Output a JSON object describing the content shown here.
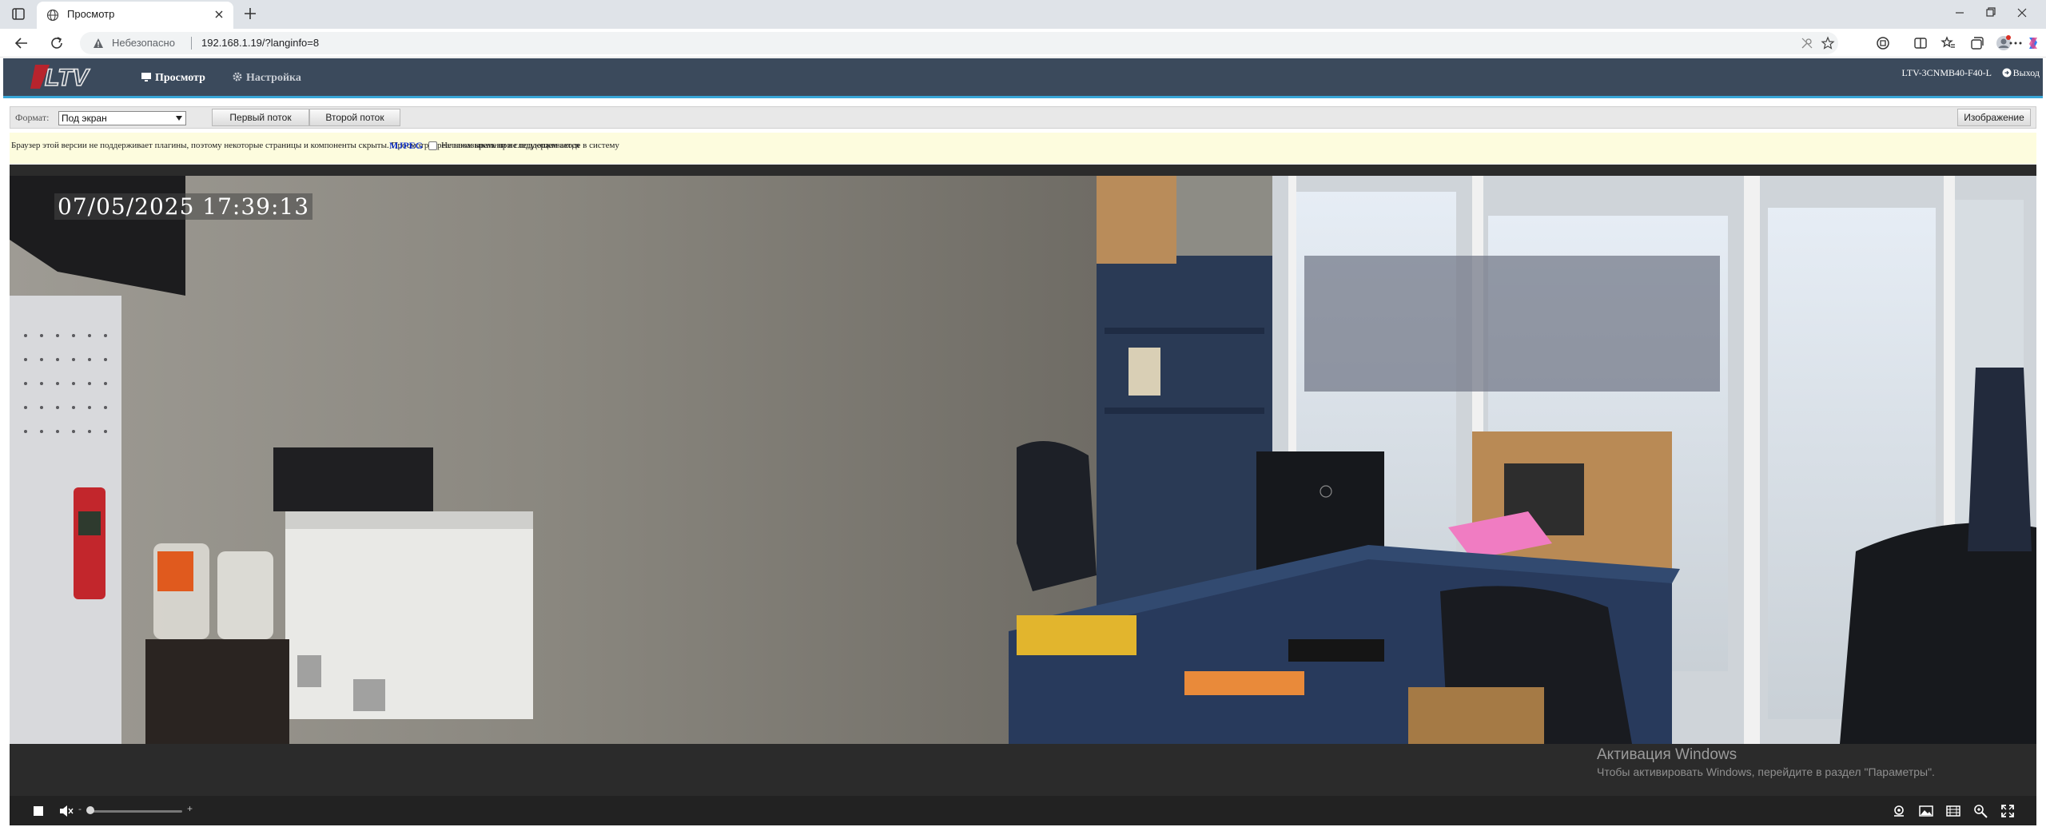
{
  "browser": {
    "tab_title": "Просмотр",
    "insecure_label": "Небезопасно",
    "url": "192.168.1.19/?langinfo=8"
  },
  "app": {
    "nav": {
      "live_label": "Просмотр",
      "settings_label": "Настройка"
    },
    "device_name": "LTV-3CNMB40-F40-L",
    "logout_label": "Выход",
    "toolbar": {
      "format_label": "Формат",
      "format_selected": "Под экран",
      "stream_first_label": "Первый поток",
      "stream_second_label": "Второй поток",
      "image_label": "Изображение"
    },
    "notice": {
      "text": "Браузер этой версии не поддерживает плагины, поэтому некоторые страницы и компоненты скрыты. Просмотр в реальном времени не поддерживается",
      "link": "MJPEG",
      "checkbox_label": "Не показывать при следующем входе в систему"
    },
    "player": {
      "osd_timestamp": "07/05/2025 17:39:13",
      "volume_minus": "-",
      "volume_plus": "+",
      "volume_level": 0
    }
  },
  "windows_activation": {
    "title": "Активация Windows",
    "subtitle": "Чтобы активировать Windows, перейдите в раздел \"Параметры\"."
  },
  "colors": {
    "header_bg": "#3b4a5c",
    "header_accent": "#38a6d8",
    "notice_bg": "#fdfcde",
    "link": "#1536c9"
  }
}
